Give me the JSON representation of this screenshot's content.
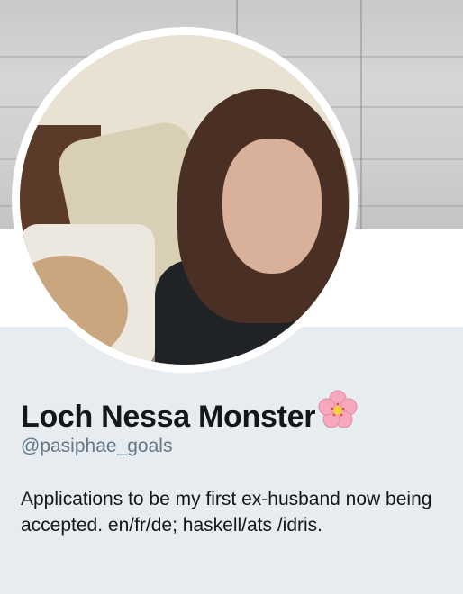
{
  "profile": {
    "display_name": "Loch Nessa Monster",
    "handle": "@pasiphae_goals",
    "bio": "Applications to be my first ex-husband now being accepted. en/fr/de; haskell/ats /idris.",
    "name_emoji": "cherry-blossom-icon"
  },
  "colors": {
    "name_text": "#14171a",
    "handle_text": "#657786",
    "info_background": "#e6ecf0"
  }
}
